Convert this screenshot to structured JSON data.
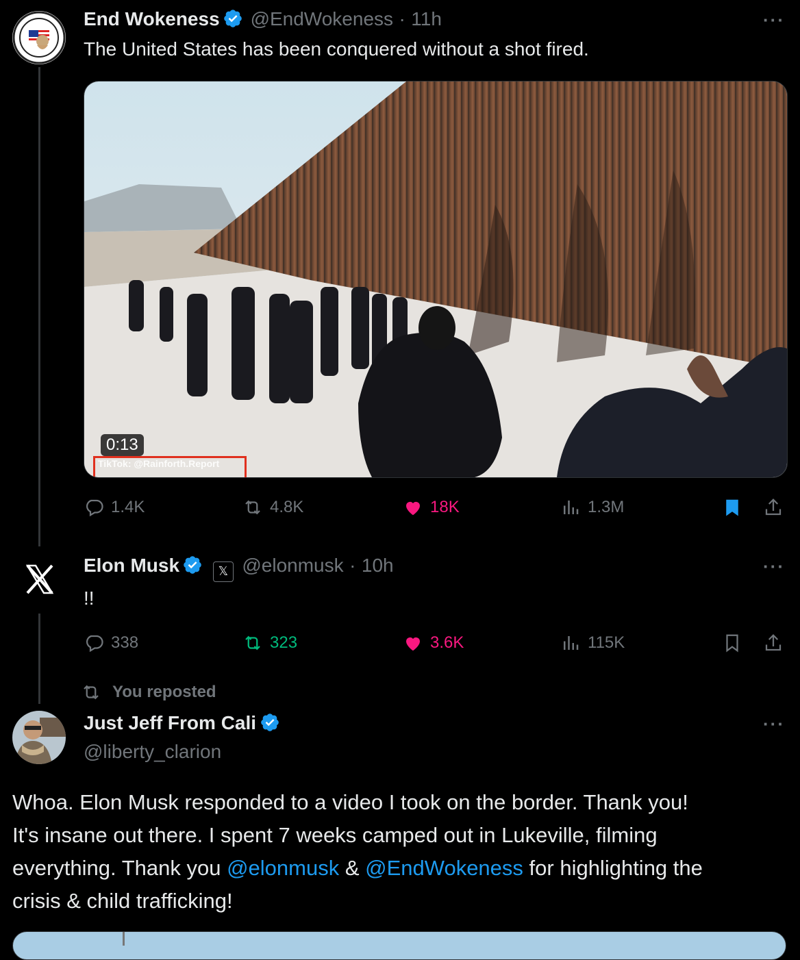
{
  "tweet1": {
    "name": "End Wokeness",
    "handle": "@EndWokeness",
    "time": "11h",
    "separator": "·",
    "text": "The United States has been conquered without a shot fired.",
    "video": {
      "duration": "0:13",
      "watermark": "TikTok: @Rainforth.Report"
    },
    "stats": {
      "replies": "1.4K",
      "reposts": "4.8K",
      "likes": "18K",
      "views": "1.3M"
    },
    "liked": true,
    "bookmarked": true
  },
  "tweet2": {
    "name": "Elon Musk",
    "handle": "@elonmusk",
    "time": "10h",
    "separator": "·",
    "text": "!!",
    "stats": {
      "replies": "338",
      "reposts": "323",
      "likes": "3.6K",
      "views": "115K"
    },
    "reposted": true,
    "liked": true,
    "bookmarked": false
  },
  "tweet3": {
    "repost_label": "You reposted",
    "name": "Just Jeff From Cali",
    "handle": "@liberty_clarion",
    "text_lines": {
      "l1": "Whoa. Elon Musk responded to a video I took on the border. Thank you!",
      "l2": "It's insane out there. I spent 7 weeks camped out in Lukeville, filming",
      "l3a": "everything. Thank you ",
      "l3_mention1": "@elonmusk",
      "l3b": " & ",
      "l3_mention2": "@EndWokeness",
      "l3c": " for highlighting the",
      "l4": "crisis & child trafficking!"
    }
  },
  "more_label": "···",
  "colors": {
    "accent": "#1d9bf0",
    "like": "#f91880",
    "repost": "#00ba7c",
    "muted": "#71767b"
  }
}
